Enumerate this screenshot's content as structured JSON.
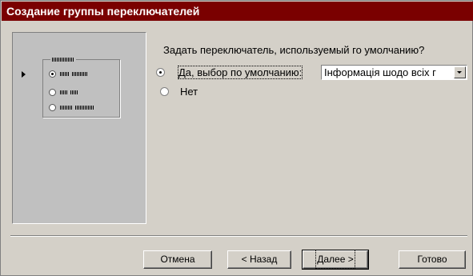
{
  "window": {
    "title": "Создание группы переключателей"
  },
  "preview": {
    "options": [
      {
        "selected": true
      },
      {
        "selected": false
      },
      {
        "selected": false
      }
    ]
  },
  "question": "Задать переключатель, используемый го умолчанию?",
  "options": {
    "yes_label": "Да, выбор по умолчанию:",
    "yes_selected": true,
    "no_label": "Нет",
    "no_selected": false
  },
  "default_select": {
    "value": "Інформація шодо всіх г"
  },
  "buttons": {
    "cancel": "Отмена",
    "back": "< Назад",
    "next": "Далее >",
    "finish": "Готово"
  },
  "colors": {
    "titlebar": "#7a0000",
    "face": "#d4d0c8"
  }
}
